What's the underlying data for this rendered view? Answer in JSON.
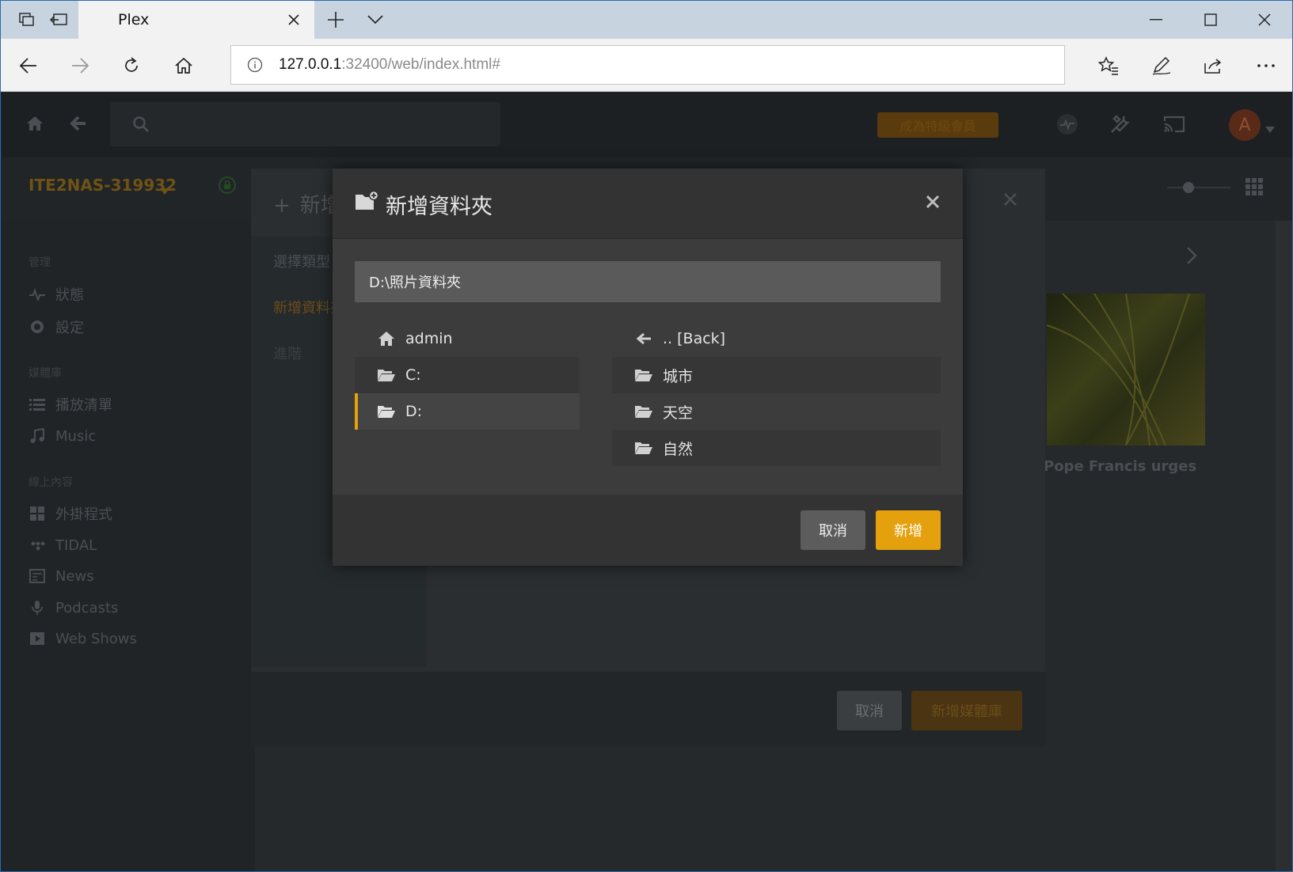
{
  "browser": {
    "tab_title": "Plex",
    "url_host": "127.0.0.1",
    "url_rest": ":32400/web/index.html#"
  },
  "plex": {
    "premium_label": "成為特級會員",
    "avatar_letter": "A",
    "server_name": "ITE2NAS-319932",
    "sidebar": {
      "section_manage": "管理",
      "status": "狀態",
      "settings": "設定",
      "section_library": "媒體庫",
      "playlists": "播放清單",
      "music": "Music",
      "section_online": "線上內容",
      "plugins": "外掛程式",
      "tidal": "TIDAL",
      "news": "News",
      "podcasts": "Podcasts",
      "webshows": "Web Shows"
    },
    "library_dialog": {
      "title": "新增媒體庫",
      "nav_select": "選擇類型",
      "nav_add_folder": "新增資料夾",
      "nav_advanced": "進階",
      "cancel": "取消",
      "add_library": "新增媒體庫"
    },
    "news_caption": "Pope Francis urges"
  },
  "folder_dialog": {
    "title": "新增資料夾",
    "path_value": "D:\\照片資料夾",
    "left_items": [
      {
        "label": "admin",
        "icon": "home-icon"
      },
      {
        "label": "C:",
        "icon": "folder-open-icon"
      },
      {
        "label": "D:",
        "icon": "folder-open-icon",
        "selected": true
      }
    ],
    "right_items": [
      {
        "label": ".. [Back]",
        "icon": "arrow-left-icon"
      },
      {
        "label": "城市",
        "icon": "folder-open-icon"
      },
      {
        "label": "天空",
        "icon": "folder-open-icon"
      },
      {
        "label": "自然",
        "icon": "folder-open-icon"
      }
    ],
    "cancel_label": "取消",
    "add_label": "新增"
  },
  "colors": {
    "accent": "#e5a00d"
  }
}
